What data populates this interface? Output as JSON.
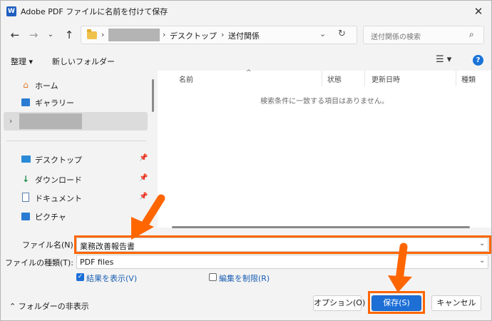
{
  "window": {
    "app_icon_letter": "W",
    "title": "Adobe PDF ファイルに名前を付けて保存",
    "close_glyph": "✕"
  },
  "address": {
    "crumbs": [
      "デスクトップ",
      "送付関係"
    ],
    "search_placeholder": "送付関係の検索"
  },
  "toolbar": {
    "organize_label": "整理 ▾",
    "new_folder_label": "新しいフォルダー"
  },
  "nav": {
    "items_top": [
      {
        "label": "ホーム",
        "icon": "home-icon"
      },
      {
        "label": "ギャラリー",
        "icon": "gallery-icon"
      }
    ],
    "items_quick": [
      {
        "label": "デスクトップ",
        "icon": "desktop-icon"
      },
      {
        "label": "ダウンロード",
        "icon": "download-icon"
      },
      {
        "label": "ドキュメント",
        "icon": "document-icon"
      },
      {
        "label": "ピクチャ",
        "icon": "pictures-icon"
      }
    ]
  },
  "list": {
    "columns": [
      "名前",
      "状態",
      "更新日時",
      "種類"
    ],
    "empty_message": "検索条件に一致する項目はありません。"
  },
  "form": {
    "filename_label": "ファイル名(N):",
    "filename_value": "業務改善報告書",
    "filetype_label": "ファイルの種類(T):",
    "filetype_value": "PDF files",
    "view_result_label": "結果を表示(V)",
    "view_result_checked": true,
    "restrict_edit_label": "編集を制限(R)",
    "restrict_edit_checked": false,
    "hide_folders_label": "フォルダーの非表示"
  },
  "buttons": {
    "options": "オプション(O)",
    "save": "保存(S)",
    "cancel": "キャンセル"
  },
  "colors": {
    "highlight": "#ff6600",
    "accent": "#1d6fd6"
  }
}
